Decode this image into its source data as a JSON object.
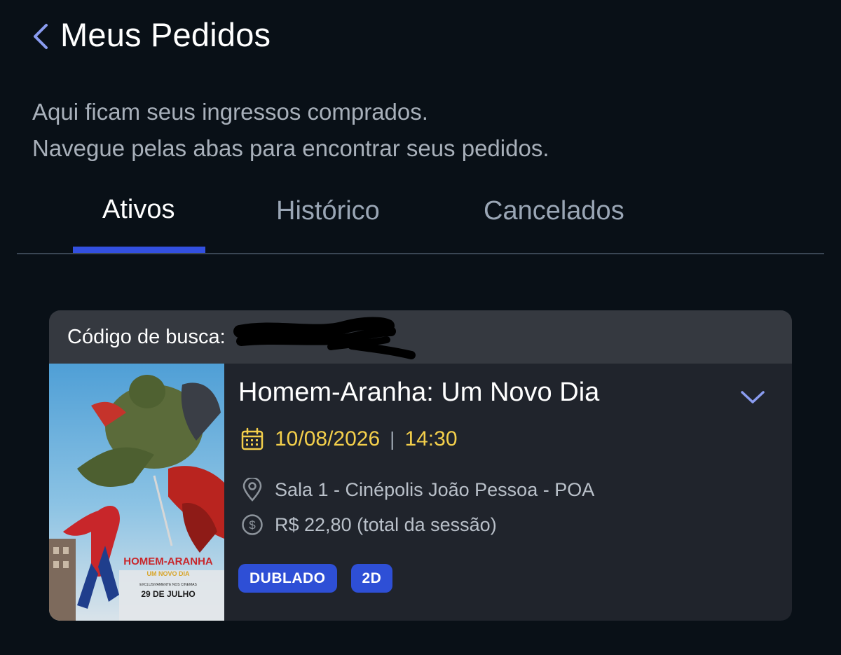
{
  "header": {
    "title": "Meus Pedidos"
  },
  "intro": {
    "line1": "Aqui ficam seus ingressos comprados.",
    "line2": "Navegue pelas abas para encontrar seus pedidos."
  },
  "tabs": [
    {
      "label": "Ativos",
      "active": true
    },
    {
      "label": "Histórico",
      "active": false
    },
    {
      "label": "Cancelados",
      "active": false
    }
  ],
  "order": {
    "code_label": "Código de busca:",
    "code_value": "",
    "movie_title": "Homem-Aranha: Um Novo Dia",
    "date": "10/08/2026",
    "time": "14:30",
    "location": "Sala 1 - Cinépolis João Pessoa - POA",
    "price": "R$ 22,80 (total da sessão)",
    "badges": [
      "DUBLADO",
      "2D"
    ],
    "poster": {
      "title_line": "HOMEM-ARANHA",
      "subtitle_line": "UM NOVO DIA",
      "caption": "EXCLUSIVAMENTE NOS CINEMAS",
      "release": "29 DE JULHO"
    }
  },
  "colors": {
    "background": "#091017",
    "accent": "#3350e0",
    "date_highlight": "#f3cf4b",
    "card": "#20242c",
    "card_header": "#353940"
  },
  "icons": {
    "back": "chevron-left-icon",
    "expand": "chevron-down-icon",
    "date": "calendar-icon",
    "location": "map-pin-icon",
    "price": "dollar-circle-icon"
  }
}
